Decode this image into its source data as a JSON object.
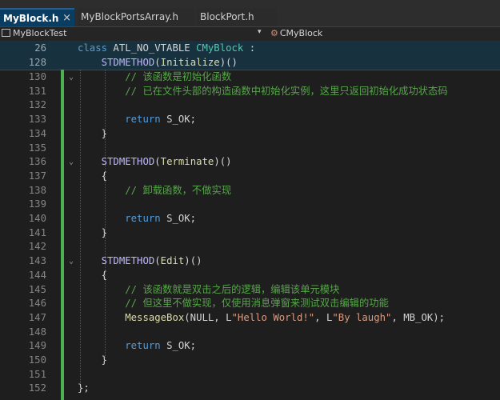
{
  "tabs": [
    {
      "label": "MyBlock.h",
      "close": "×"
    },
    {
      "label": "MyBlockPortsArray.h"
    },
    {
      "label": "BlockPort.h"
    }
  ],
  "nav": {
    "project": "MyBlockTest",
    "dropdown": "▾",
    "scope_icon": "class-icon",
    "scope": "CMyBlock"
  },
  "sticky": [
    {
      "n": "26",
      "parts": [
        [
          "kw",
          "class "
        ],
        [
          "",
          "ATL_NO_VTABLE "
        ],
        [
          "cls",
          "CMyBlock"
        ],
        [
          "",
          " :"
        ]
      ]
    },
    {
      "n": "128",
      "parts": [
        [
          "",
          "    "
        ],
        [
          "mac",
          "STDMETHOD"
        ],
        [
          "",
          "("
        ],
        [
          "fn",
          "Initialize"
        ],
        [
          "",
          ")()"
        ]
      ]
    }
  ],
  "lines": [
    {
      "n": "130",
      "parts": [
        [
          "",
          "        "
        ],
        [
          "cm",
          "// 该函数是初始化函数"
        ]
      ]
    },
    {
      "n": "131",
      "parts": [
        [
          "",
          "        "
        ],
        [
          "cm",
          "// 已在文件头部的构造函数中初始化实例，这里只返回初始化成功状态码"
        ]
      ]
    },
    {
      "n": "132",
      "parts": []
    },
    {
      "n": "133",
      "parts": [
        [
          "",
          "        "
        ],
        [
          "kw",
          "return "
        ],
        [
          "",
          "S_OK;"
        ]
      ]
    },
    {
      "n": "134",
      "parts": [
        [
          "",
          "    }"
        ]
      ]
    },
    {
      "n": "135",
      "parts": []
    },
    {
      "n": "136",
      "parts": [
        [
          "",
          "    "
        ],
        [
          "mac",
          "STDMETHOD"
        ],
        [
          "",
          "("
        ],
        [
          "fn",
          "Terminate"
        ],
        [
          "",
          ")()"
        ]
      ]
    },
    {
      "n": "137",
      "parts": [
        [
          "",
          "    {"
        ]
      ]
    },
    {
      "n": "138",
      "parts": [
        [
          "",
          "        "
        ],
        [
          "cm",
          "// 卸载函数，不做实现"
        ]
      ]
    },
    {
      "n": "139",
      "parts": []
    },
    {
      "n": "140",
      "parts": [
        [
          "",
          "        "
        ],
        [
          "kw",
          "return "
        ],
        [
          "",
          "S_OK;"
        ]
      ]
    },
    {
      "n": "141",
      "parts": [
        [
          "",
          "    }"
        ]
      ]
    },
    {
      "n": "142",
      "parts": []
    },
    {
      "n": "143",
      "parts": [
        [
          "",
          "    "
        ],
        [
          "mac",
          "STDMETHOD"
        ],
        [
          "",
          "("
        ],
        [
          "fn",
          "Edit"
        ],
        [
          "",
          ")()"
        ]
      ]
    },
    {
      "n": "144",
      "parts": [
        [
          "",
          "    {"
        ]
      ]
    },
    {
      "n": "145",
      "parts": [
        [
          "",
          "        "
        ],
        [
          "cm",
          "// 该函数就是双击之后的逻辑，编辑该单元模块"
        ]
      ]
    },
    {
      "n": "146",
      "parts": [
        [
          "",
          "        "
        ],
        [
          "cm",
          "// 但这里不做实现，仅使用消息弹窗来测试双击编辑的功能"
        ]
      ]
    },
    {
      "n": "147",
      "parts": [
        [
          "",
          "        "
        ],
        [
          "fn",
          "MessageBox"
        ],
        [
          "",
          "(NULL, L"
        ],
        [
          "str",
          "\"Hello World!\""
        ],
        [
          "",
          ", L"
        ],
        [
          "str",
          "\"By laugh\""
        ],
        [
          "",
          ", MB_OK);"
        ]
      ]
    },
    {
      "n": "148",
      "parts": []
    },
    {
      "n": "149",
      "parts": [
        [
          "",
          "        "
        ],
        [
          "kw",
          "return "
        ],
        [
          "",
          "S_OK;"
        ]
      ]
    },
    {
      "n": "150",
      "parts": [
        [
          "",
          "    }"
        ]
      ]
    },
    {
      "n": "151",
      "parts": []
    },
    {
      "n": "152",
      "parts": [
        [
          "",
          "};"
        ]
      ]
    }
  ],
  "fold_lines": [
    "130",
    "136",
    "143"
  ],
  "fold_glyph": "⌄",
  "colors": {
    "change_bar": "#4caf50",
    "active_tab": "#0a3d62"
  }
}
